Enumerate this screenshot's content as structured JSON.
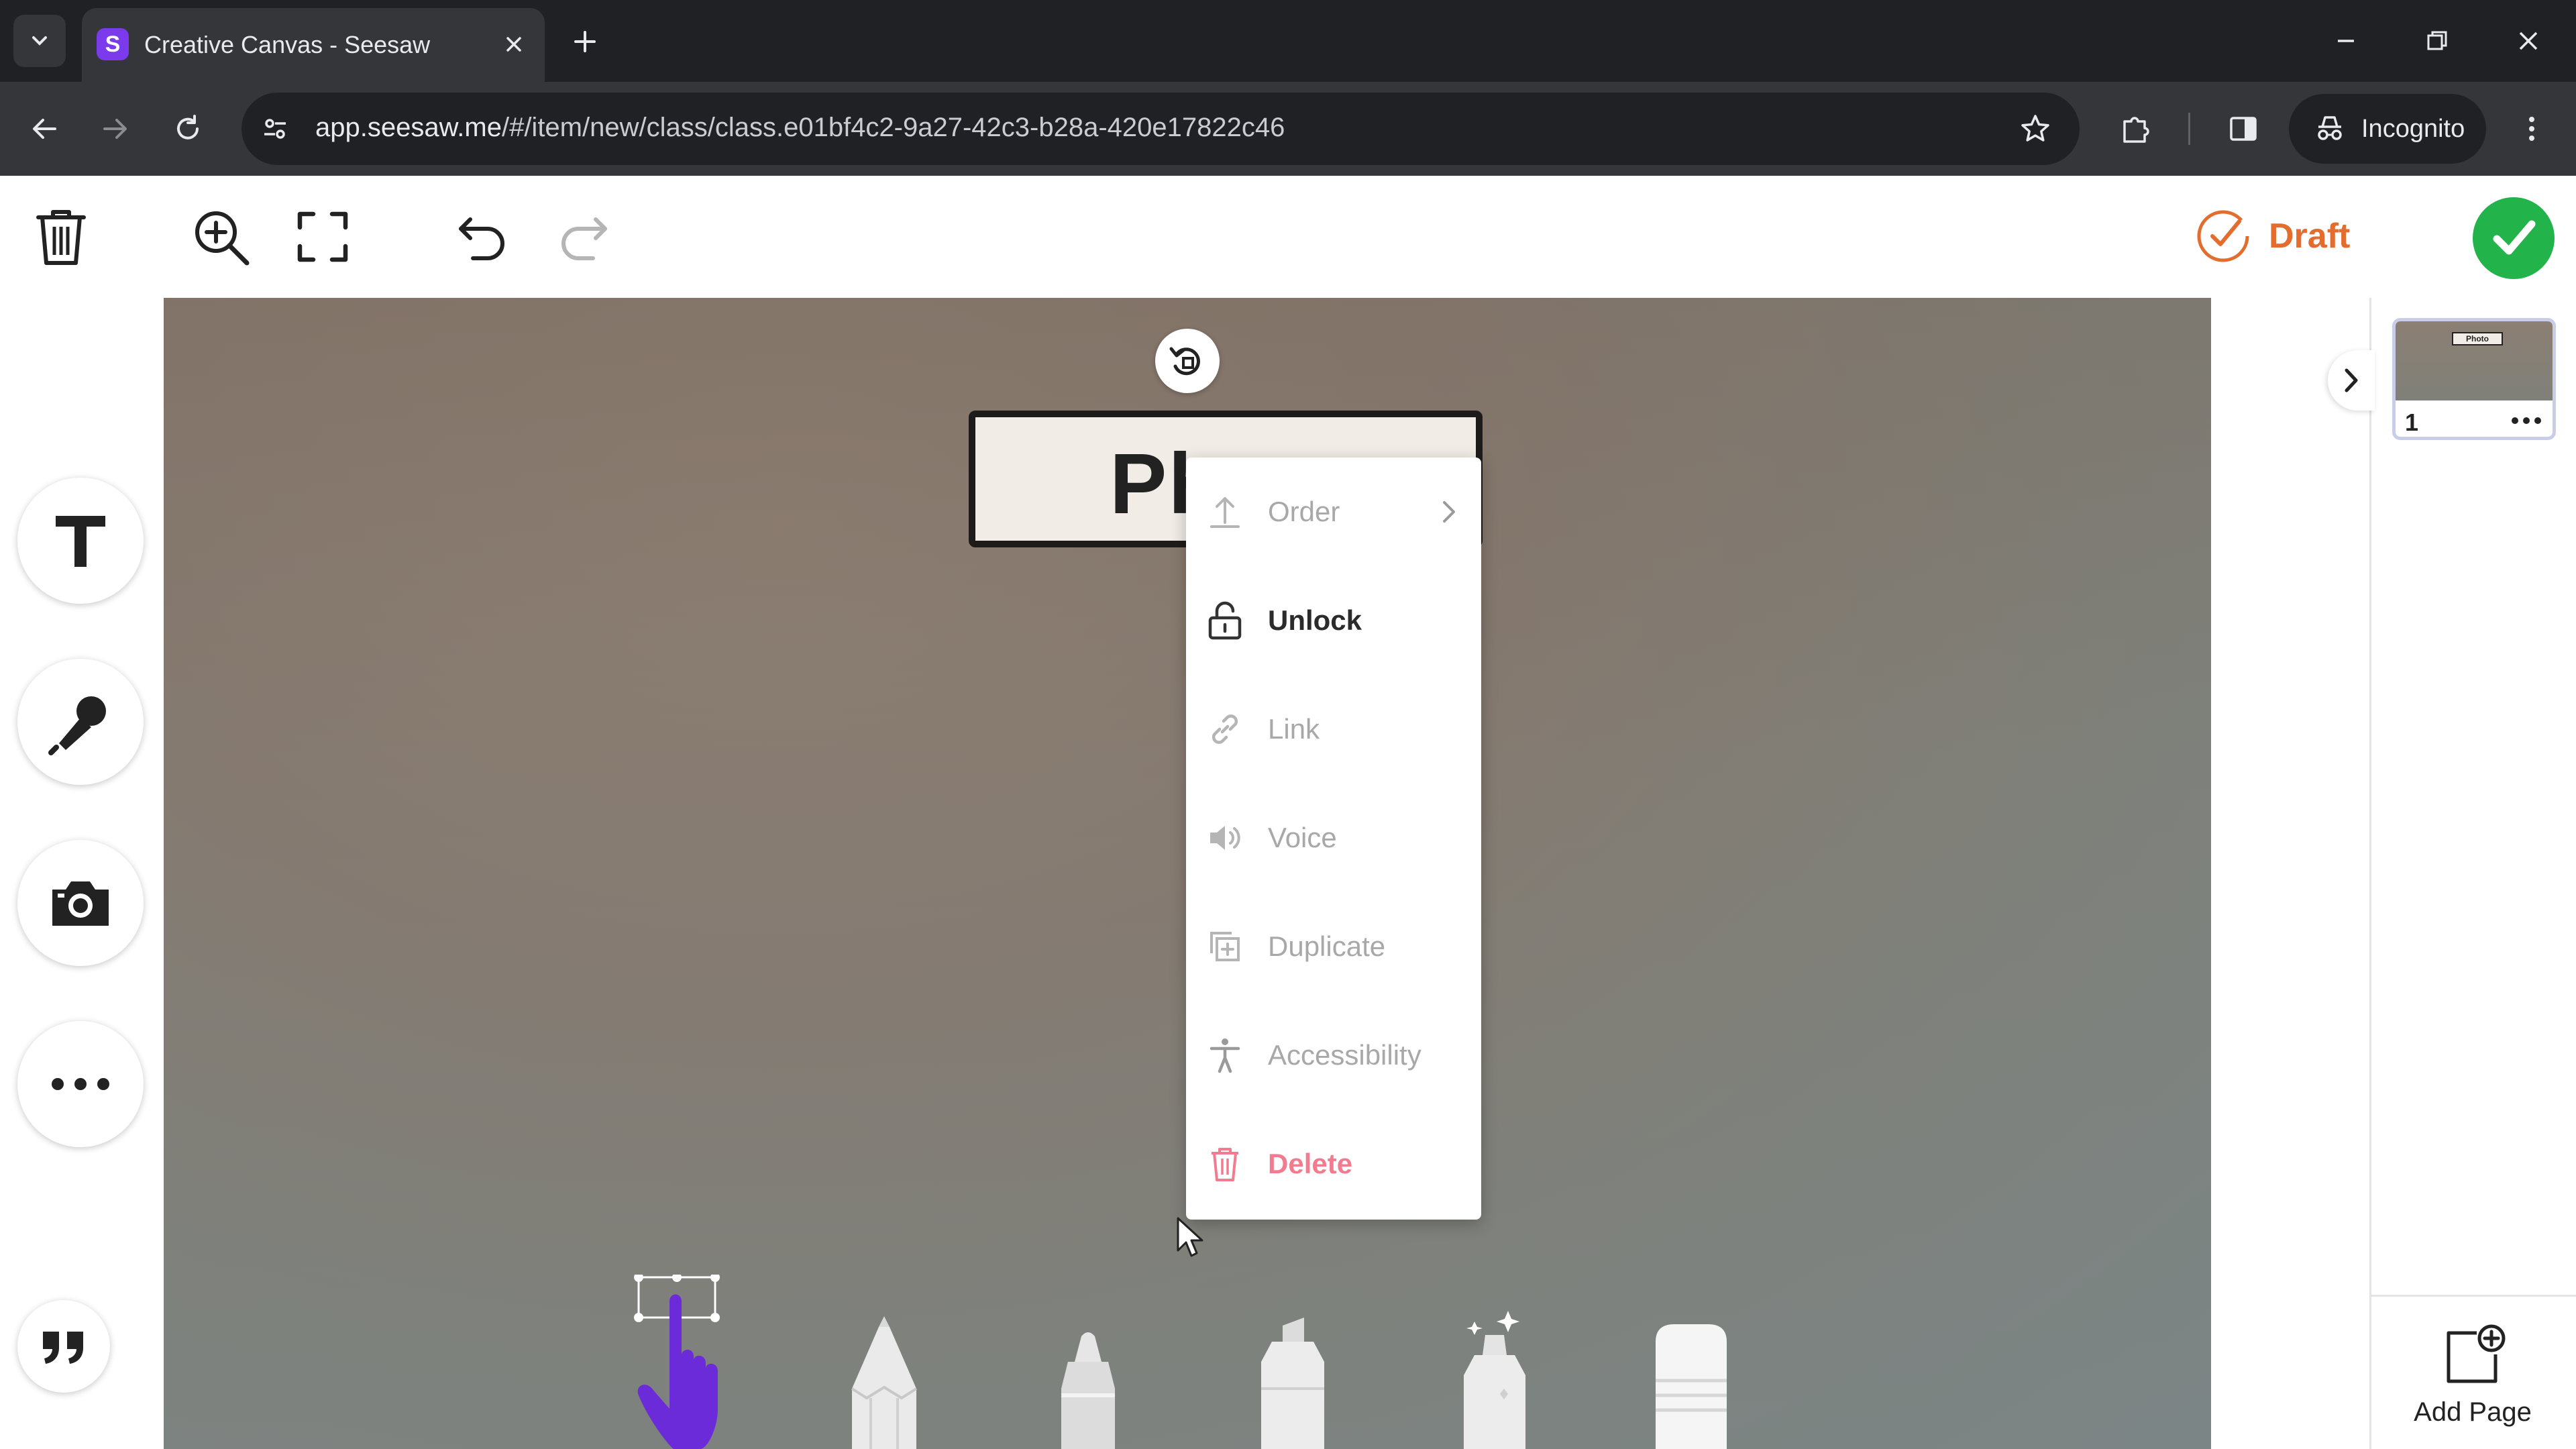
{
  "browser": {
    "tab_title": "Creative Canvas - Seesaw",
    "favicon_letter": "S",
    "url_host": "app.seesaw.me",
    "url_path": "/#/item/new/class/class.e01bf4c2-9a27-42c3-b28a-420e17822c46",
    "incognito_label": "Incognito"
  },
  "app_toolbar": {
    "draft_label": "Draft"
  },
  "canvas": {
    "photo_label_text": "Ph"
  },
  "context_menu": {
    "items": [
      {
        "label": "Order",
        "state": "disabled",
        "icon": "order-icon",
        "has_submenu": true
      },
      {
        "label": "Unlock",
        "state": "active",
        "icon": "unlock-icon"
      },
      {
        "label": "Link",
        "state": "disabled",
        "icon": "link-icon"
      },
      {
        "label": "Voice",
        "state": "disabled",
        "icon": "voice-icon"
      },
      {
        "label": "Duplicate",
        "state": "disabled",
        "icon": "duplicate-icon"
      },
      {
        "label": "Accessibility",
        "state": "disabled",
        "icon": "accessibility-icon"
      },
      {
        "label": "Delete",
        "state": "danger",
        "icon": "trash-icon"
      }
    ]
  },
  "pages_panel": {
    "thumbnail_number": "1",
    "thumbnail_label": "Photo",
    "add_page_label": "Add Page"
  },
  "colors": {
    "chrome_dark": "#202124",
    "chrome_mid": "#35363a",
    "draft_orange": "#e26d2e",
    "done_green": "#22b34a",
    "pointer_purple": "#6c2bd9",
    "delete_pink": "#f27b8f"
  }
}
